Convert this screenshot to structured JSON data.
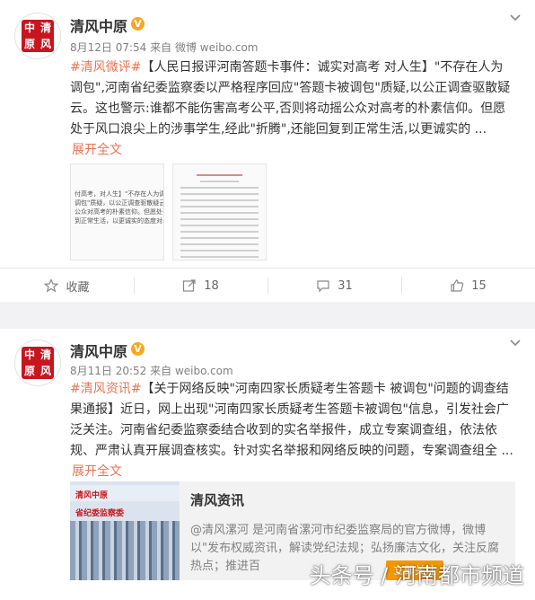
{
  "post1": {
    "avatar_chars": [
      "中",
      "清",
      "原",
      "风"
    ],
    "nickname": "清风中原",
    "verified_mark": "V",
    "date": "8月12日 07:54",
    "source": "来自 微博 weibo.com",
    "hashtag": "#清风微评#",
    "body": "【人民日报评河南答题卡事件：诚实对高考 对人生】\"不存在人为调包\",河南省纪委监察委以严格程序回应\"答题卡被调包\"质疑,以公正调查驱散疑云。这也警示:谁都不能伤害高考公平,否则将动摇公众对高考的朴素信仰。但愿处于风口浪尖上的涉事学生,经此\"折腾\",还能回复到正常生活,以更诚实的 ...",
    "expand": "展开全文",
    "thumb1_lines": [
      "付高考，对人生】\"不存在人为调包\"，河南",
      "调包\"质疑，以公正调查驱散疑云。这也警",
      "公众对高考的朴素信仰。但愿处于风口浪",
      "到正常生活，以更诚实的态度对未来。"
    ],
    "actions": [
      {
        "icon": "star-icon",
        "label": "收藏"
      },
      {
        "icon": "share-icon",
        "label": "18"
      },
      {
        "icon": "comment-icon",
        "label": "31"
      },
      {
        "icon": "like-icon",
        "label": "15"
      }
    ]
  },
  "post2": {
    "avatar_chars": [
      "中",
      "清",
      "原",
      "风"
    ],
    "nickname": "清风中原",
    "verified_mark": "V",
    "date": "8月11日 20:52",
    "source": "来自 weibo.com",
    "hashtag": "#清风资讯#",
    "body": "【关于网络反映\"河南四家长质疑考生答题卡 被调包\"问题的调查结果通报】近日，网上出现\"河南四家长质疑考生答题卡被调包\"信息，引发社会广泛关注。河南省纪委监察委结合收到的实名举报件，成立专案调查组，依法依规、严肃认真开展调查核实。针对实名举报和网络反映的问题，专案调查组全 ...",
    "expand": "展开全文",
    "link_card": {
      "image_text_1": "清风中原",
      "image_text_2": "省纪委监察委",
      "title": "清风资讯",
      "description": "@清风漯河 是河南省漯河市纪委监察局的官方微博，微博以\"发布权威资讯，解读党纪法规；弘扬廉洁文化，关注反腐热点；推进百",
      "button": "立即关注"
    }
  },
  "watermark": "头条号 / 河南都市频道",
  "colors": {
    "accent": "#eb7350",
    "brand_red": "#c8161e",
    "verified": "#f8a620"
  }
}
